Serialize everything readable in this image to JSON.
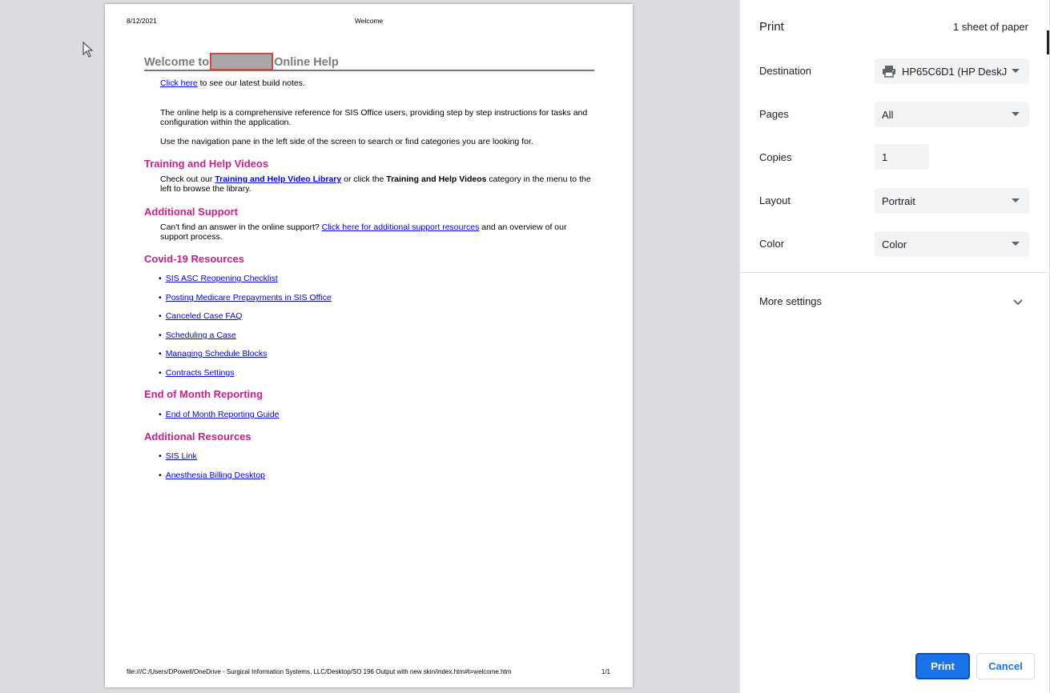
{
  "preview": {
    "header_date": "8/12/2021",
    "header_title": "Welcome",
    "footer_path": "file:///C:/Users/DPowell/OneDrive - Surgical Information Systems, LLC/Desktop/SO 196 Output with new skin/index.htm#t=welcome.htm",
    "footer_page": "1/1",
    "welcome_prefix": "Welcome to",
    "welcome_suffix": "Online Help",
    "build_link": "Click here",
    "build_text": " to see our latest build notes.",
    "intro_p1": "The online help is a comprehensive reference for SIS Office users, providing step by step instructions for tasks and configuration within the application.",
    "intro_p2": "Use the navigation pane in the left side of the screen to search or find categories you are looking for.",
    "training": {
      "heading": "Training and Help Videos",
      "text_a": "Check out our ",
      "link": "Training and Help Video Library",
      "text_b": " or click the ",
      "bold": "Training and Help Videos",
      "text_c": " category in the menu to the left to browse the library."
    },
    "support": {
      "heading": "Additional Support",
      "text_a": "Can't find an answer in the online support? ",
      "link": "Click here for additional support resources",
      "text_b": " and an overview of our support process."
    },
    "covid": {
      "heading": "Covid-19 Resources",
      "links": [
        "SIS ASC Reopening Checklist",
        "Posting Medicare Prepayments in SIS Office",
        "Canceled Case FAQ",
        "Scheduling a Case",
        "Managing Schedule Blocks",
        "Contracts Settings"
      ]
    },
    "eom": {
      "heading": "End of Month Reporting",
      "links": [
        "End of Month Reporting Guide"
      ]
    },
    "resources": {
      "heading": "Additional Resources",
      "links": [
        "SIS Link",
        "Anesthesia Billing Desktop"
      ]
    }
  },
  "panel": {
    "title": "Print",
    "sheets": "1 sheet of paper",
    "destination_label": "Destination",
    "destination_value": "HP65C6D1 (HP DeskJ",
    "pages_label": "Pages",
    "pages_value": "All",
    "copies_label": "Copies",
    "copies_value": "1",
    "layout_label": "Layout",
    "layout_value": "Portrait",
    "color_label": "Color",
    "color_value": "Color",
    "more_settings": "More settings",
    "print_button": "Print",
    "cancel_button": "Cancel"
  },
  "colors": {
    "accent": "#1a73e8",
    "heading": "#cc1f8a",
    "link": "#0000ee",
    "redaction_border": "#e0413a"
  },
  "icons": [
    "cursor-arrow-icon",
    "printer-icon",
    "chevron-down-icon",
    "dropdown-caret-icon"
  ]
}
